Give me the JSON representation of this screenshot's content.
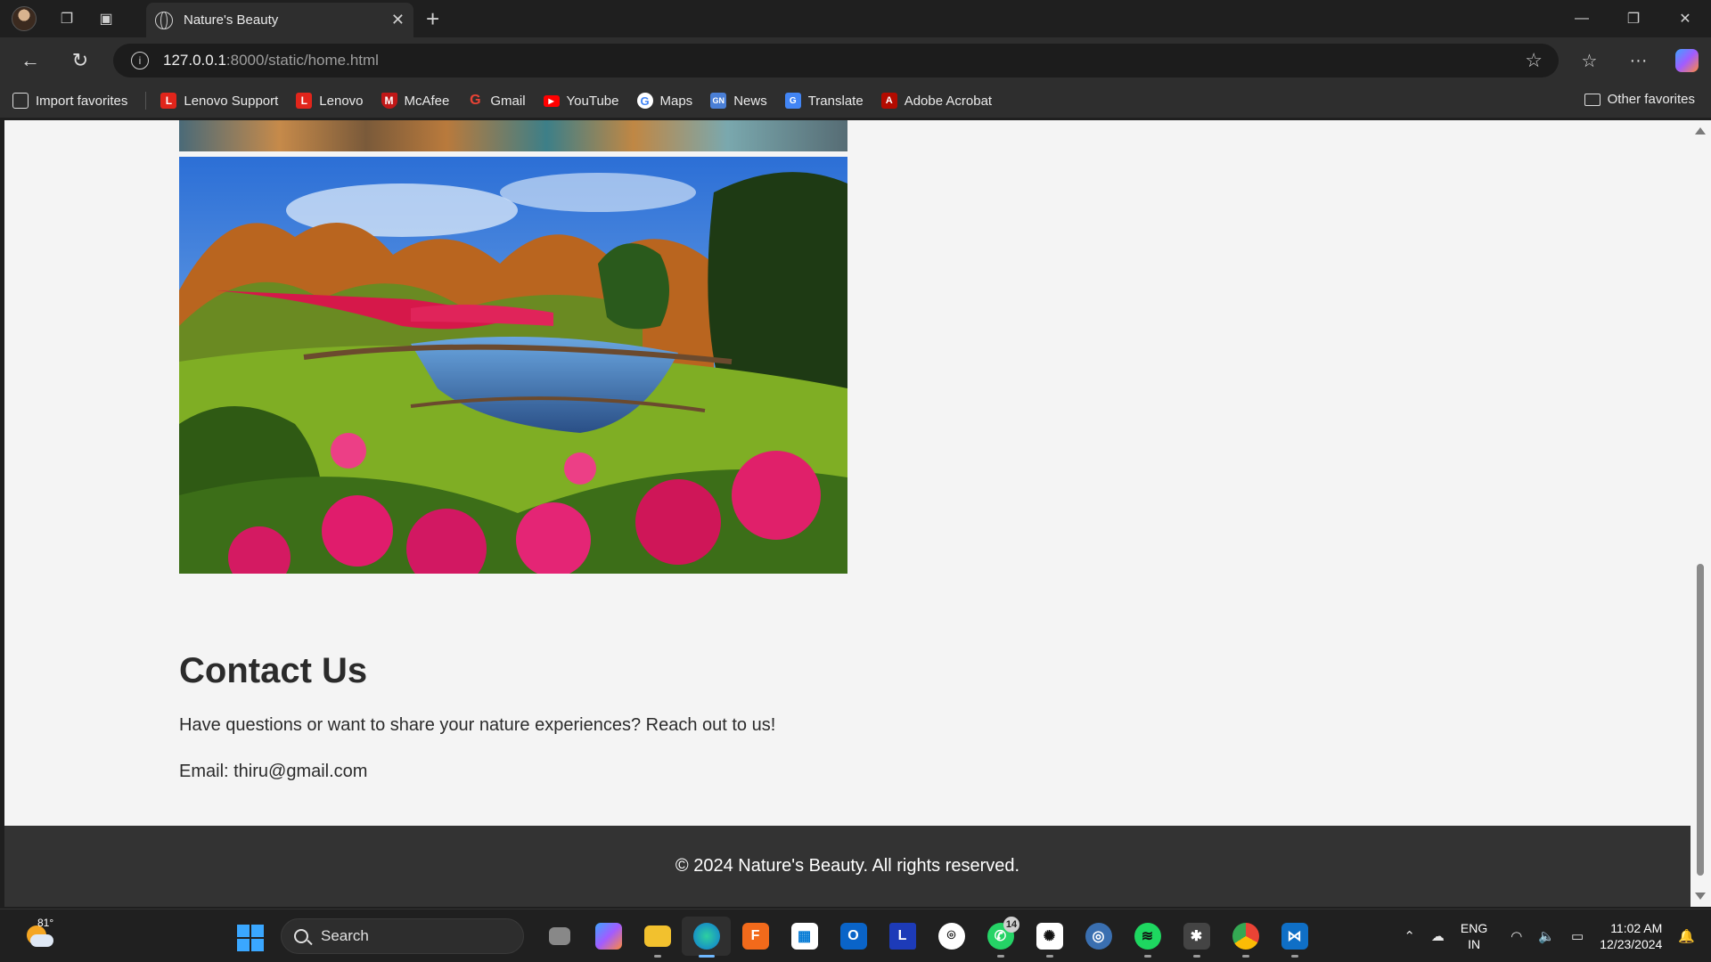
{
  "browser": {
    "tab_title": "Nature's Beauty",
    "url_host": "127.0.0.1",
    "url_path": ":8000/static/home.html"
  },
  "favorites": {
    "items": [
      {
        "label": "Import favorites",
        "icon": "import-icon"
      },
      {
        "label": "Lenovo Support",
        "icon": "lenovo-icon"
      },
      {
        "label": "Lenovo",
        "icon": "lenovo-icon"
      },
      {
        "label": "McAfee",
        "icon": "mcafee-icon"
      },
      {
        "label": "Gmail",
        "icon": "google-icon"
      },
      {
        "label": "YouTube",
        "icon": "youtube-icon"
      },
      {
        "label": "Maps",
        "icon": "google-icon"
      },
      {
        "label": "News",
        "icon": "news-icon"
      },
      {
        "label": "Translate",
        "icon": "translate-icon"
      },
      {
        "label": "Adobe Acrobat",
        "icon": "acrobat-icon"
      }
    ],
    "other": "Other favorites"
  },
  "page": {
    "contact_title": "Contact Us",
    "contact_text": "Have questions or want to share your nature experiences? Reach out to us!",
    "contact_email": "Email: thiru@gmail.com",
    "footer": "© 2024 Nature's Beauty. All rights reserved."
  },
  "taskbar": {
    "weather_temp": "81°",
    "search_placeholder": "Search",
    "whatsapp_badge": "14",
    "lang_line1": "ENG",
    "lang_line2": "IN",
    "time": "11:02 AM",
    "date": "12/23/2024"
  },
  "colors": {
    "page_bg": "#f4f4f4",
    "footer_bg": "#333333",
    "text": "#2b2b2b"
  }
}
